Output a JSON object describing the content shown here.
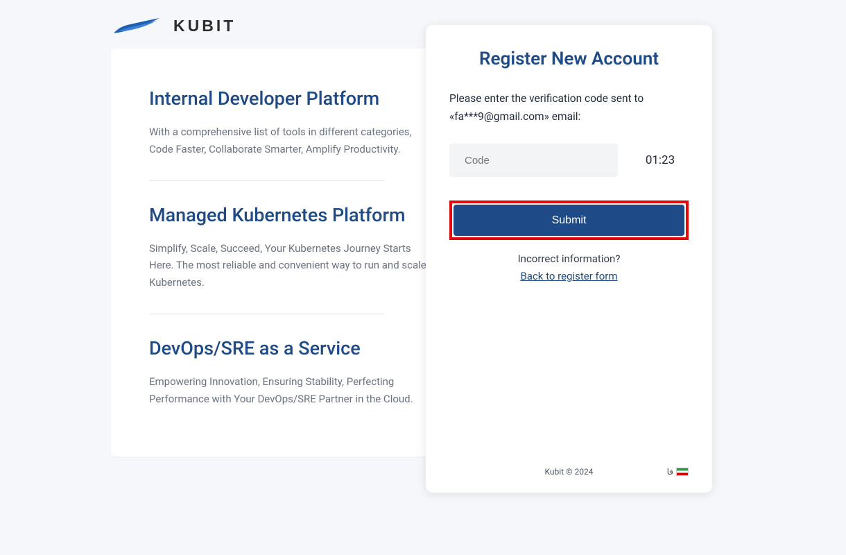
{
  "brand": {
    "name": "KUBIT"
  },
  "left": {
    "features": [
      {
        "title": "Internal Developer Platform",
        "desc": "With a comprehensive list of tools in different categories, Code Faster, Collaborate Smarter, Amplify Productivity."
      },
      {
        "title": "Managed Kubernetes Platform",
        "desc": "Simplify, Scale, Succeed, Your Kubernetes Journey Starts Here. The most reliable and convenient way to run and scale Kubernetes."
      },
      {
        "title": "DevOps/SRE as a Service",
        "desc": "Empowering Innovation, Ensuring Stability, Perfecting Performance with Your DevOps/SRE Partner in the Cloud."
      }
    ]
  },
  "right": {
    "title": "Register New Account",
    "instruction": "Please enter the verification code sent to «fa***9@gmail.com» email:",
    "code_placeholder": "Code",
    "code_value": "",
    "timer": "01:23",
    "submit": "Submit",
    "incorrect": "Incorrect information?",
    "back_link": "Back to register form",
    "copyright": "Kubit © 2024",
    "lang_label": "فا"
  }
}
